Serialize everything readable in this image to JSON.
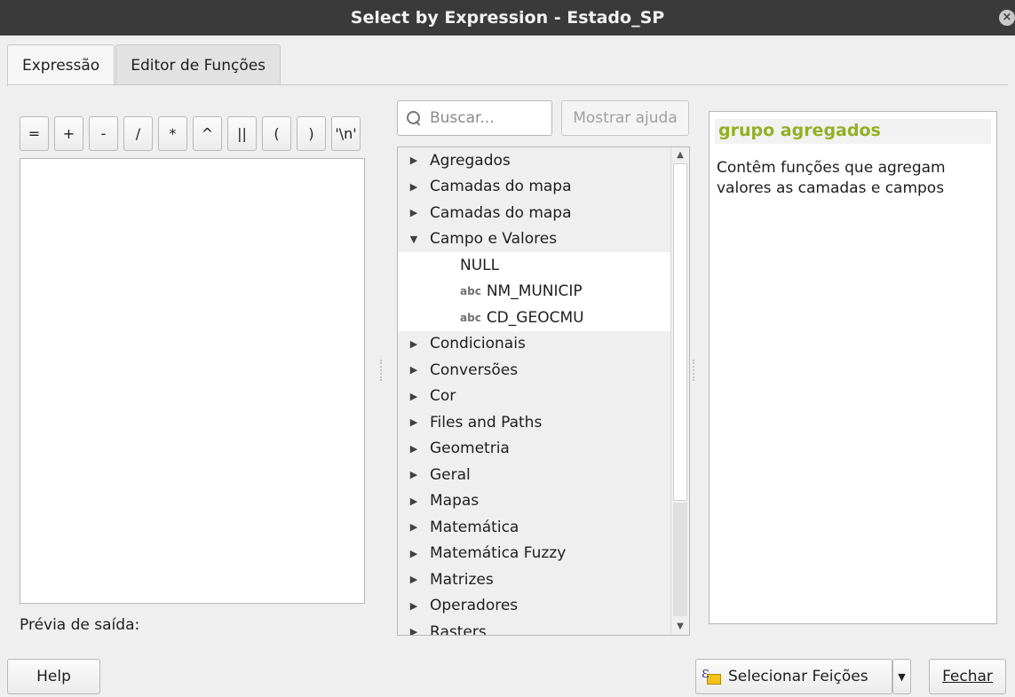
{
  "window": {
    "title": "Select by Expression - Estado_SP"
  },
  "tabs": [
    {
      "label": "Expressão",
      "active": true
    },
    {
      "label": "Editor de Funções",
      "active": false
    }
  ],
  "operators": [
    "=",
    "+",
    "-",
    "/",
    "*",
    "^",
    "||",
    "(",
    ")",
    "'\\n'"
  ],
  "expression": {
    "value": ""
  },
  "preview": {
    "label": "Prévia de saída:"
  },
  "search": {
    "placeholder": "Buscar...",
    "value": ""
  },
  "help_toggle": {
    "label": "Mostrar ajuda"
  },
  "tree": {
    "items": [
      {
        "label": "Agregados",
        "type": "group",
        "expanded": false
      },
      {
        "label": "Camadas do mapa",
        "type": "group",
        "expanded": false
      },
      {
        "label": "Camadas do mapa",
        "type": "group",
        "expanded": false
      },
      {
        "label": "Campo e Valores",
        "type": "group",
        "expanded": true
      },
      {
        "label": "NULL",
        "type": "value"
      },
      {
        "label": "NM_MUNICIP",
        "type": "field",
        "field_type": "abc"
      },
      {
        "label": "CD_GEOCMU",
        "type": "field",
        "field_type": "abc"
      },
      {
        "label": "Condicionais",
        "type": "group",
        "expanded": false
      },
      {
        "label": "Conversões",
        "type": "group",
        "expanded": false
      },
      {
        "label": "Cor",
        "type": "group",
        "expanded": false
      },
      {
        "label": "Files and Paths",
        "type": "group",
        "expanded": false
      },
      {
        "label": "Geometria",
        "type": "group",
        "expanded": false
      },
      {
        "label": "Geral",
        "type": "group",
        "expanded": false
      },
      {
        "label": "Mapas",
        "type": "group",
        "expanded": false
      },
      {
        "label": "Matemática",
        "type": "group",
        "expanded": false
      },
      {
        "label": "Matemática Fuzzy",
        "type": "group",
        "expanded": false
      },
      {
        "label": "Matrizes",
        "type": "group",
        "expanded": false
      },
      {
        "label": "Operadores",
        "type": "group",
        "expanded": false
      },
      {
        "label": "Rasters",
        "type": "group",
        "expanded": false
      }
    ]
  },
  "help_panel": {
    "title": "grupo agregados",
    "body": "Contêm funções que agregam valores as camadas e campos"
  },
  "buttons": {
    "help": "Help",
    "select": "Selecionar Feições",
    "close": "Fechar"
  },
  "colors": {
    "titlebar": "#3a3a3a",
    "help_title": "#93b023",
    "background": "#efefef"
  }
}
